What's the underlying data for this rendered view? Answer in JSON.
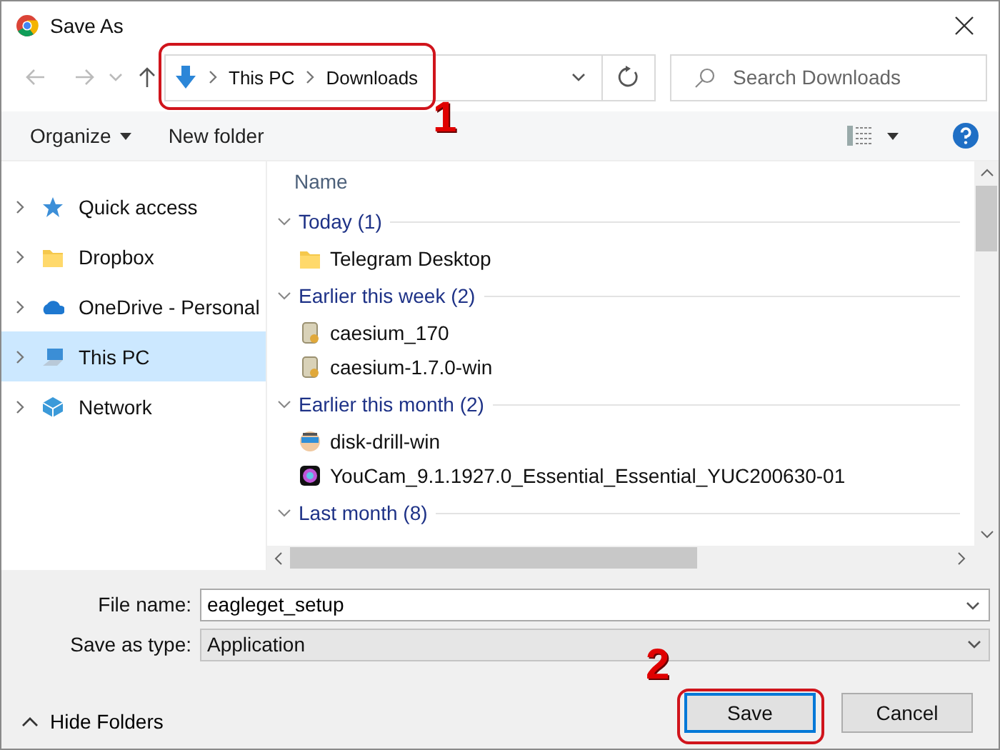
{
  "window": {
    "title": "Save As"
  },
  "address": {
    "crumbs": [
      "This PC",
      "Downloads"
    ]
  },
  "search": {
    "placeholder": "Search Downloads"
  },
  "toolbar": {
    "organize": "Organize",
    "new_folder": "New folder"
  },
  "sidebar": {
    "items": [
      {
        "label": "Quick access",
        "kind": "star",
        "selected": false
      },
      {
        "label": "Dropbox",
        "kind": "folder",
        "selected": false
      },
      {
        "label": "OneDrive - Personal",
        "kind": "cloud",
        "selected": false
      },
      {
        "label": "This PC",
        "kind": "pc",
        "selected": true
      },
      {
        "label": "Network",
        "kind": "network",
        "selected": false
      }
    ]
  },
  "file_list": {
    "columns": [
      "Name"
    ],
    "groups": [
      {
        "label": "Today (1)",
        "expanded": true,
        "items": [
          {
            "name": "Telegram Desktop",
            "kind": "folder"
          }
        ]
      },
      {
        "label": "Earlier this week (2)",
        "expanded": true,
        "items": [
          {
            "name": "caesium_170",
            "kind": "archive"
          },
          {
            "name": "caesium-1.7.0-win",
            "kind": "archive"
          }
        ]
      },
      {
        "label": "Earlier this month (2)",
        "expanded": true,
        "items": [
          {
            "name": "disk-drill-win",
            "kind": "app"
          },
          {
            "name": "YouCam_9.1.1927.0_Essential_Essential_YUC200630-01",
            "kind": "camera"
          }
        ]
      },
      {
        "label": "Last month (8)",
        "expanded": true
      }
    ]
  },
  "form": {
    "file_name_label": "File name:",
    "file_name": "eagleget_setup",
    "type_label": "Save as type:",
    "type": "Application"
  },
  "hide_folders": "Hide Folders",
  "buttons": [
    {
      "label": "Save",
      "default": true
    },
    {
      "label": "Cancel",
      "default": false
    }
  ],
  "annotations": [
    {
      "label": "1"
    },
    {
      "label": "2"
    }
  ]
}
